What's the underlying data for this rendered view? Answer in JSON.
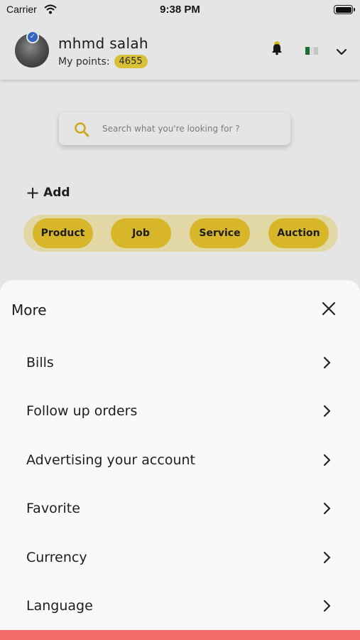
{
  "status_bar": {
    "carrier": "Carrier",
    "time": "9:38 PM"
  },
  "header": {
    "user_name": "mhmd salah",
    "points_label": "My points:",
    "points_value": "4655",
    "icons": [
      "verified-badge-icon",
      "notification-bell-icon",
      "country-flag-icon",
      "chevron-down-icon"
    ]
  },
  "search": {
    "placeholder": "Search what you're looking for ?"
  },
  "add": {
    "label": "Add"
  },
  "categories": [
    {
      "label": "Product"
    },
    {
      "label": "Job"
    },
    {
      "label": "Service"
    },
    {
      "label": "Auction"
    }
  ],
  "sheet": {
    "title": "More",
    "items": [
      {
        "label": "Bills"
      },
      {
        "label": "Follow up orders"
      },
      {
        "label": "Advertising your account"
      },
      {
        "label": "Favorite"
      },
      {
        "label": "Currency"
      },
      {
        "label": "Language"
      }
    ]
  },
  "colors": {
    "accent_yellow": "#f0cc2e",
    "bottom_strip": "#f56a6a",
    "verified_blue": "#3b6fd8"
  }
}
